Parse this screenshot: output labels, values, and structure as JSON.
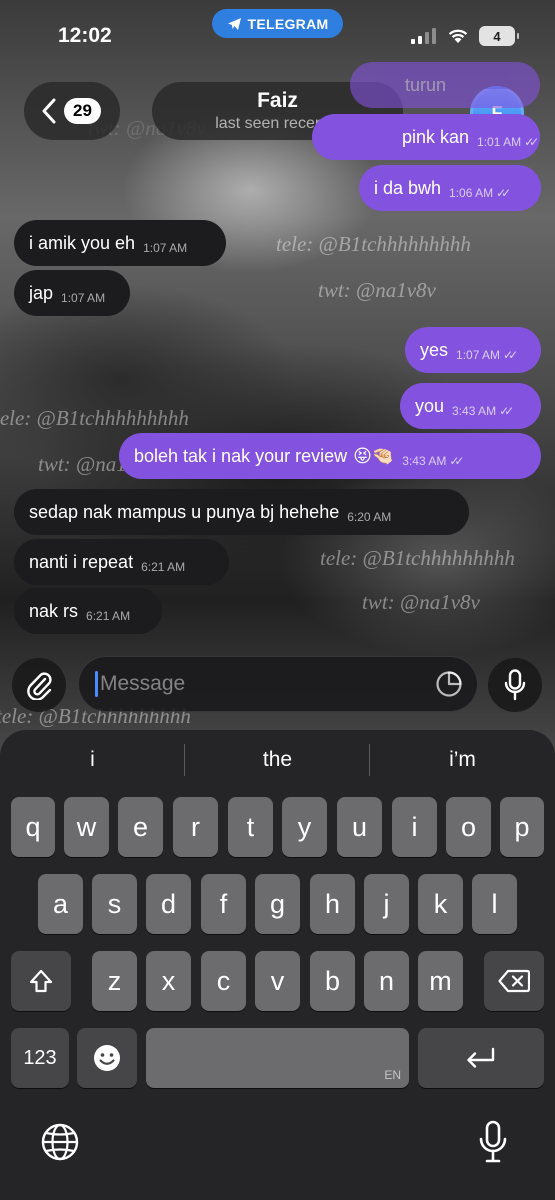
{
  "status_bar": {
    "time": "12:02",
    "app_pill": "TELEGRAM",
    "battery": "4"
  },
  "header": {
    "back_count": "29",
    "name": "Faiz",
    "subtitle": "last seen recently",
    "avatar_initial": "F",
    "avatar_color": "#2c7fe8"
  },
  "watermarks": [
    "tele: @B1tchhhhhhhhh",
    "twt: @na1v8v",
    "tele: @B1tchhhhhhhhh",
    "twt: @na1v8v",
    "tele: @B1tchhhhhhhhh",
    "twt: @na1v8v",
    "twt: @na1v8v",
    "tele: @B1tchhhhhhhhh"
  ],
  "messages": [
    {
      "direction": "out",
      "text": "turun",
      "time": "",
      "partial": true
    },
    {
      "direction": "out",
      "text": "pink kan",
      "time": "1:01 AM",
      "partial": true
    },
    {
      "direction": "out",
      "text": "i da bwh",
      "time": "1:06 AM"
    },
    {
      "direction": "in",
      "text": "i amik you eh",
      "time": "1:07 AM"
    },
    {
      "direction": "in",
      "text": "jap",
      "time": "1:07 AM"
    },
    {
      "direction": "out",
      "text": "yes",
      "time": "1:07 AM"
    },
    {
      "direction": "out",
      "text": "you",
      "time": "3:43 AM"
    },
    {
      "direction": "out",
      "text": "boleh tak i nak your review",
      "emoji": "😝🤏🏻",
      "time": "3:43 AM"
    },
    {
      "direction": "in",
      "text": "sedap nak mampus u punya bj hehehe",
      "time": "6:20 AM"
    },
    {
      "direction": "in",
      "text": "nanti i repeat",
      "time": "6:21 AM"
    },
    {
      "direction": "in",
      "text": "nak rs",
      "time": "6:21 AM"
    }
  ],
  "composer": {
    "placeholder": "Message",
    "value": ""
  },
  "keyboard": {
    "suggestions": [
      "i",
      "the",
      "i’m"
    ],
    "row1": [
      "q",
      "w",
      "e",
      "r",
      "t",
      "y",
      "u",
      "i",
      "o",
      "p"
    ],
    "row2": [
      "a",
      "s",
      "d",
      "f",
      "g",
      "h",
      "j",
      "k",
      "l"
    ],
    "row3": [
      "z",
      "x",
      "c",
      "v",
      "b",
      "n",
      "m"
    ],
    "numbers_key": "123",
    "space_lang": "EN",
    "accent_color": "#8353e0"
  }
}
